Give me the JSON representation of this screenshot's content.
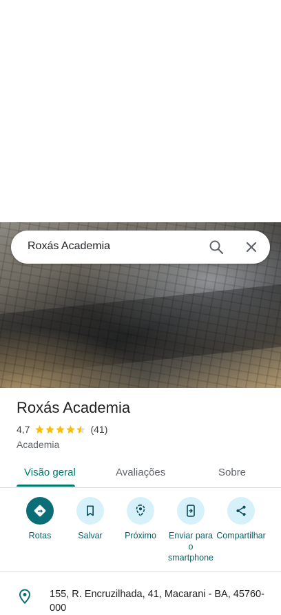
{
  "search": {
    "query": "Roxás Academia"
  },
  "place": {
    "title": "Roxás Academia",
    "rating": "4,7",
    "rating_value": 4.7,
    "review_count": "(41)",
    "category": "Academia",
    "address": "155, R. Encruzilhada, 41, Macarani - BA, 45760-000"
  },
  "tabs": [
    {
      "label": "Visão geral"
    },
    {
      "label": "Avaliações"
    },
    {
      "label": "Sobre"
    }
  ],
  "actions": [
    {
      "label": "Rotas",
      "icon": "directions-icon"
    },
    {
      "label": "Salvar",
      "icon": "bookmark-icon"
    },
    {
      "label": "Próximo",
      "icon": "nearby-icon"
    },
    {
      "label": "Enviar para o smartphone",
      "icon": "send-to-phone-icon"
    },
    {
      "label": "Compartilhar",
      "icon": "share-icon"
    }
  ],
  "colors": {
    "accent": "#00796b",
    "action_bg": "#d7f1fa",
    "primary_action": "#0b6e77",
    "star": "#fbbc04"
  }
}
